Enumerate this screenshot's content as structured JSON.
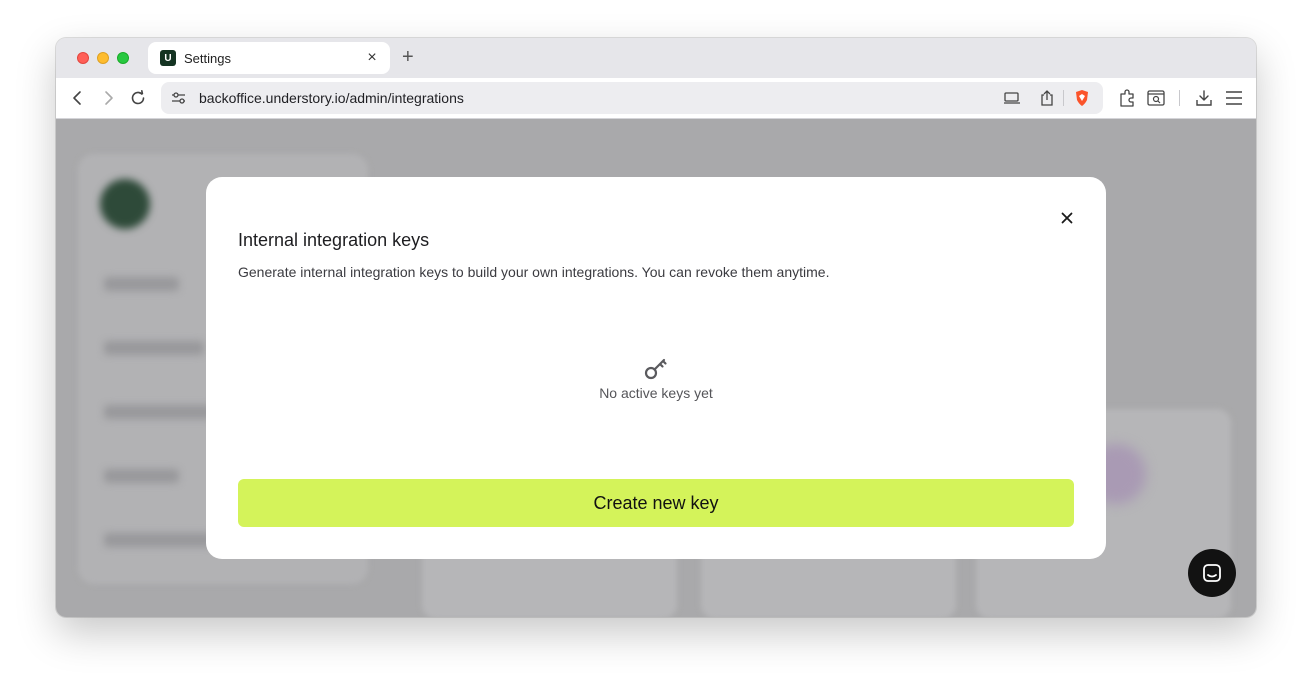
{
  "browser": {
    "tab": {
      "favicon_letter": "U",
      "title": "Settings",
      "close": "×"
    },
    "new_tab": "+",
    "url": "backoffice.understory.io/admin/integrations"
  },
  "modal": {
    "title": "Internal integration keys",
    "description": "Generate internal integration keys to build your own integrations. You can revoke them anytime.",
    "empty_state": {
      "icon": "key-icon",
      "text": "No active keys yet"
    },
    "create_button": "Create new key",
    "close": "close-icon"
  },
  "colors": {
    "accent": "#d4f35a",
    "favicon_bg": "#143322",
    "overlay": "#a9a9ab",
    "chat_bg": "#121212"
  }
}
